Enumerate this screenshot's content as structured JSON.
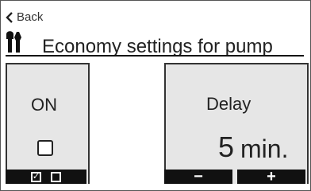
{
  "header": {
    "back_label": "Back",
    "title": "Economy settings for pump"
  },
  "left_panel": {
    "label": "ON",
    "checked": false
  },
  "right_panel": {
    "label": "Delay",
    "value": "5",
    "unit": "min."
  },
  "softkeys": {
    "left": {
      "checked_symbol": "✓"
    },
    "minus": "−",
    "plus": "+"
  },
  "icons": {
    "back": "chevron-left-icon",
    "settings": "tools-icon"
  }
}
